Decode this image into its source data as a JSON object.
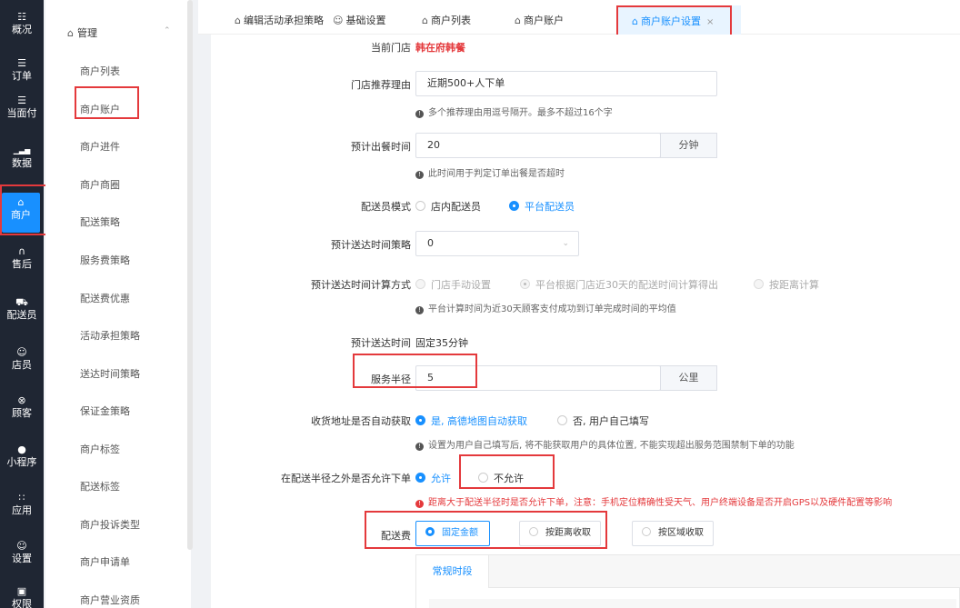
{
  "nav": {
    "items": [
      {
        "icon": "grid-icon",
        "glyph": "☷",
        "label": "概况"
      },
      {
        "icon": "list-icon",
        "glyph": "☰",
        "label": "订单"
      },
      {
        "icon": "list-icon",
        "glyph": "☰",
        "label": "当面付"
      },
      {
        "icon": "bar-chart-icon",
        "glyph": "▁▃▅",
        "label": "数据"
      },
      {
        "icon": "store-icon",
        "glyph": "⌂",
        "label": "商户"
      },
      {
        "icon": "headset-icon",
        "glyph": "∩",
        "label": "售后"
      },
      {
        "icon": "courier-icon",
        "glyph": "⛟",
        "label": "配送员"
      },
      {
        "icon": "user-icon",
        "glyph": "☺",
        "label": "店员"
      },
      {
        "icon": "customer-icon",
        "glyph": "⊗",
        "label": "顾客"
      },
      {
        "icon": "wechat-icon",
        "glyph": "●",
        "label": "小程序"
      },
      {
        "icon": "apps-icon",
        "glyph": "∷",
        "label": "应用"
      },
      {
        "icon": "settings-icon",
        "glyph": "☺",
        "label": "设置"
      },
      {
        "icon": "lock-icon",
        "glyph": "▣",
        "label": "权限"
      }
    ]
  },
  "sidebar": {
    "group": "管理",
    "group_icon": "⌂",
    "items": [
      "商户列表",
      "商户账户",
      "商户进件",
      "商户商圈",
      "配送策略",
      "服务费策略",
      "配送费优惠",
      "活动承担策略",
      "送达时间策略",
      "保证金策略",
      "商户标签",
      "配送标签",
      "商户投诉类型",
      "商户申请单",
      "商户营业资质"
    ]
  },
  "tabs": [
    {
      "label": "编辑活动承担策略",
      "icon": "store-icon"
    },
    {
      "label": "基础设置",
      "icon": "user-icon"
    },
    {
      "label": "商户列表",
      "icon": "store-icon"
    },
    {
      "label": "商户账户",
      "icon": "store-icon"
    },
    {
      "label": "商户账户设置",
      "icon": "store-icon",
      "close": "×"
    }
  ],
  "form": {
    "current_store_label": "当前门店",
    "current_store_value": "韩在府韩餐",
    "recommend_label": "门店推荐理由",
    "recommend_value": "近期500+人下单",
    "recommend_hint": "多个推荐理由用逗号隔开。最多不超过16个字",
    "prep_label": "预计出餐时间",
    "prep_value": "20",
    "prep_unit": "分钟",
    "prep_hint": "此时间用于判定订单出餐是否超时",
    "courier_mode_label": "配送员模式",
    "courier_mode_options": [
      "店内配送员",
      "平台配送员"
    ],
    "eta_strategy_label": "预计送达时间策略",
    "eta_strategy_value": "0",
    "eta_calc_label": "预计送达时间计算方式",
    "eta_calc_options": [
      "门店手动设置",
      "平台根据门店近30天的配送时间计算得出",
      "按距离计算"
    ],
    "eta_calc_hint": "平台计算时间为近30天顾客支付成功到订单完成时间的平均值",
    "eta_label": "预计送达时间",
    "eta_value": "固定35分钟",
    "radius_label": "服务半径",
    "radius_value": "5",
    "radius_unit": "公里",
    "auto_addr_label": "收货地址是否自动获取",
    "auto_addr_options": [
      "是, 高德地图自动获取",
      "否, 用户自己填写"
    ],
    "auto_addr_hint": "设置为用户自己填写后, 将不能获取用户的具体位置, 不能实现超出服务范围禁制下单的功能",
    "outside_label": "在配送半径之外是否允许下单",
    "outside_options": [
      "允许",
      "不允许"
    ],
    "outside_hint": "距离大于配送半径时是否允许下单，注意：手机定位精确性受天气、用户终端设备是否开启GPS以及硬件配置等影响",
    "fee_label": "配送费",
    "fee_options": [
      "固定金额",
      "按距离收取",
      "按区域收取"
    ],
    "sub_tab": "常规时段"
  }
}
